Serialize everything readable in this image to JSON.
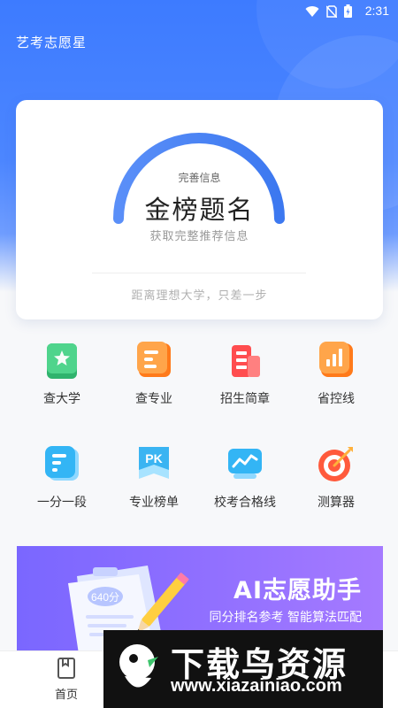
{
  "status_bar": {
    "time": "2:31"
  },
  "app": {
    "title": "艺考志愿星"
  },
  "hero": {
    "gauge_label": "完善信息",
    "title": "金榜题名",
    "subtitle": "获取完整推荐信息",
    "footer": "距离理想大学，只差一步",
    "accent_color": "#4a86f7"
  },
  "menu": [
    {
      "label": "查大学",
      "icon": "book-star-icon",
      "color": "#33c47d"
    },
    {
      "label": "查专业",
      "icon": "document-icon",
      "color": "#ff8a2a"
    },
    {
      "label": "招生简章",
      "icon": "building-icon",
      "color": "#ff4d4f"
    },
    {
      "label": "省控线",
      "icon": "bar-chart-icon",
      "color": "#ff8a2a"
    },
    {
      "label": "一分一段",
      "icon": "segments-icon",
      "color": "#2db7f5"
    },
    {
      "label": "专业榜单",
      "icon": "pk-icon",
      "color": "#3ab4f2"
    },
    {
      "label": "校考合格线",
      "icon": "trend-icon",
      "color": "#2db7f5"
    },
    {
      "label": "测算器",
      "icon": "target-icon",
      "color": "#ff5a3c"
    }
  ],
  "banner": {
    "title": "AI志愿助手",
    "subtitle": "同分排名参考 智能算法匹配",
    "score_tag": "640分"
  },
  "tabbar": {
    "home": "首页"
  },
  "watermark": {
    "title": "下载鸟资源",
    "url": "www.xiazainiao.com"
  }
}
